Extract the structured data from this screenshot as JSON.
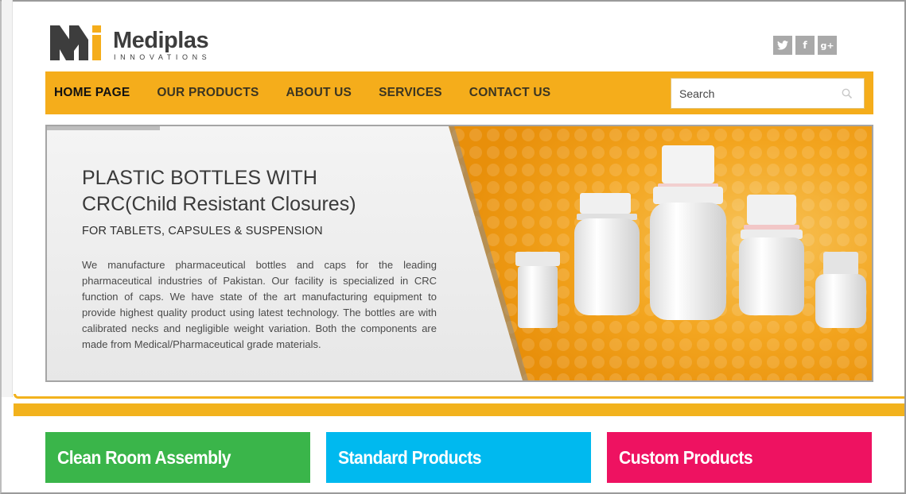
{
  "brand": {
    "name": "Mediplas",
    "tagline": "INNOVATIONS",
    "colors": {
      "orange": "#f5ad1b",
      "dark": "#3d3d3d"
    }
  },
  "social": [
    {
      "icon": "twitter-icon",
      "glyph": "🐦"
    },
    {
      "icon": "facebook-icon",
      "glyph": "f"
    },
    {
      "icon": "google-plus-icon",
      "glyph": "g+"
    }
  ],
  "nav": {
    "items": [
      {
        "label": "HOME PAGE",
        "active": true
      },
      {
        "label": "OUR PRODUCTS"
      },
      {
        "label": "ABOUT US"
      },
      {
        "label": "SERVICES"
      },
      {
        "label": "CONTACT US"
      }
    ],
    "search_placeholder": "Search"
  },
  "banner": {
    "title_line1": "PLASTIC BOTTLES WITH",
    "title_line2": "CRC(Child Resistant Closures)",
    "subtitle": "FOR TABLETS, CAPSULES & SUSPENSION",
    "body": "We manufacture pharmaceutical bottles and caps for the leading pharmaceutical industries of Pakistan. Our facility is specialized in CRC function of caps. We have state of the art manufacturing equipment to provide highest quality product using latest technology. The bottles are with calibrated necks and negligible weight variation. Both the components are made from Medical/Pharmaceutical grade materials."
  },
  "cards": [
    {
      "label": "Clean Room Assembly",
      "color": "#3ab54a"
    },
    {
      "label": "Standard Products",
      "color": "#00b9ef"
    },
    {
      "label": "Custom Products",
      "color": "#ee1261"
    }
  ]
}
